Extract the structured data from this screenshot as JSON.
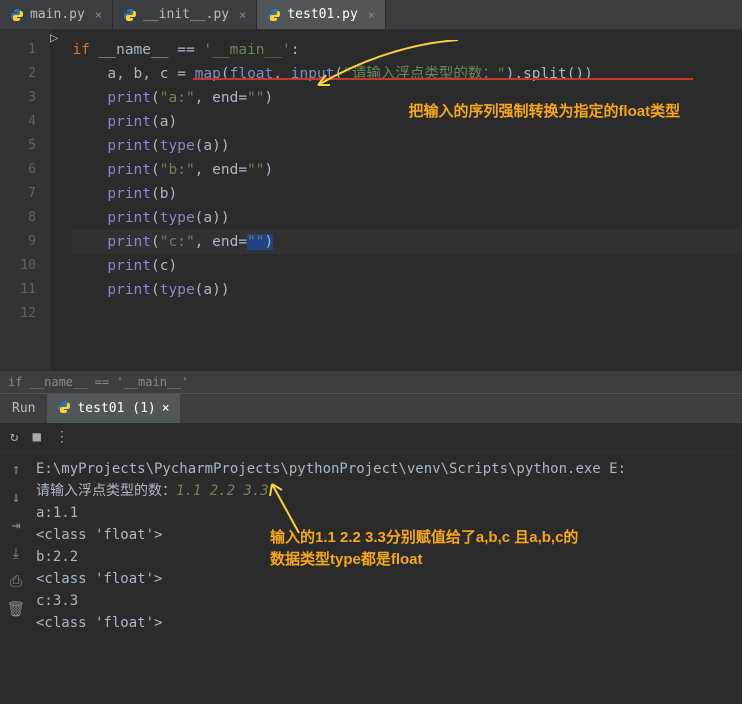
{
  "tabs": [
    {
      "label": "main.py"
    },
    {
      "label": "__init__.py"
    },
    {
      "label": "test01.py"
    }
  ],
  "code_lines": {
    "line1": {
      "kw1": "if",
      "var": "__name__",
      "eq": "==",
      "str": "'__main__'",
      "colon": ":"
    },
    "line2": {
      "indent": "    ",
      "vars": "a, b, c = ",
      "map": "map",
      "p1": "(",
      "float": "float",
      "comma": ", ",
      "input": "input",
      "p2": "(",
      "str": "\"请输入浮点类型的数：\"",
      "p3": ").split())"
    },
    "line3": {
      "indent": "    ",
      "print": "print",
      "p1": "(",
      "str": "\"a:\"",
      "comma": ", ",
      "end": "end",
      "eq": "=",
      "str2": "\"\"",
      "p2": ")"
    },
    "line4": {
      "indent": "    ",
      "print": "print",
      "args": "(a)"
    },
    "line5": {
      "indent": "    ",
      "print": "print",
      "p1": "(",
      "type": "type",
      "args": "(a))"
    },
    "line6": {
      "indent": "    ",
      "print": "print",
      "p1": "(",
      "str": "\"b:\"",
      "comma": ", ",
      "end": "end",
      "eq": "=",
      "str2": "\"\"",
      "p2": ")"
    },
    "line7": {
      "indent": "    ",
      "print": "print",
      "args": "(b)"
    },
    "line8": {
      "indent": "    ",
      "print": "print",
      "p1": "(",
      "type": "type",
      "args": "(a))"
    },
    "line9": {
      "indent": "    ",
      "print": "print",
      "p1": "(",
      "str": "\"c:\"",
      "comma": ", ",
      "end": "end",
      "eq": "=",
      "str2": "\"\"",
      "p2": ")"
    },
    "line10": {
      "indent": "    ",
      "print": "print",
      "args": "(c)"
    },
    "line11": {
      "indent": "    ",
      "print": "print",
      "p1": "(",
      "type": "type",
      "args": "(a))"
    }
  },
  "gutter": [
    "1",
    "2",
    "3",
    "4",
    "5",
    "6",
    "7",
    "8",
    "9",
    "10",
    "11",
    "12"
  ],
  "annotation1": "把输入的序列强制转换为指定的float类型",
  "breadcrumb": "if __name__ == '__main__'",
  "run": {
    "label": "Run",
    "tab": "test01 (1)",
    "output": {
      "path": "E:\\myProjects\\PycharmProjects\\pythonProject\\venv\\Scripts\\python.exe E:",
      "prompt": "请输入浮点类型的数：",
      "input": "1.1 2.2 3.3",
      "lines": [
        "a:1.1",
        "<class 'float'>",
        "b:2.2",
        "<class 'float'>",
        "c:3.3",
        "<class 'float'>"
      ]
    }
  },
  "annotation2_l1": "输入的1.1 2.2 3.3分别赋值给了a,b,c 且a,b,c的",
  "annotation2_l2": "数据类型type都是float"
}
